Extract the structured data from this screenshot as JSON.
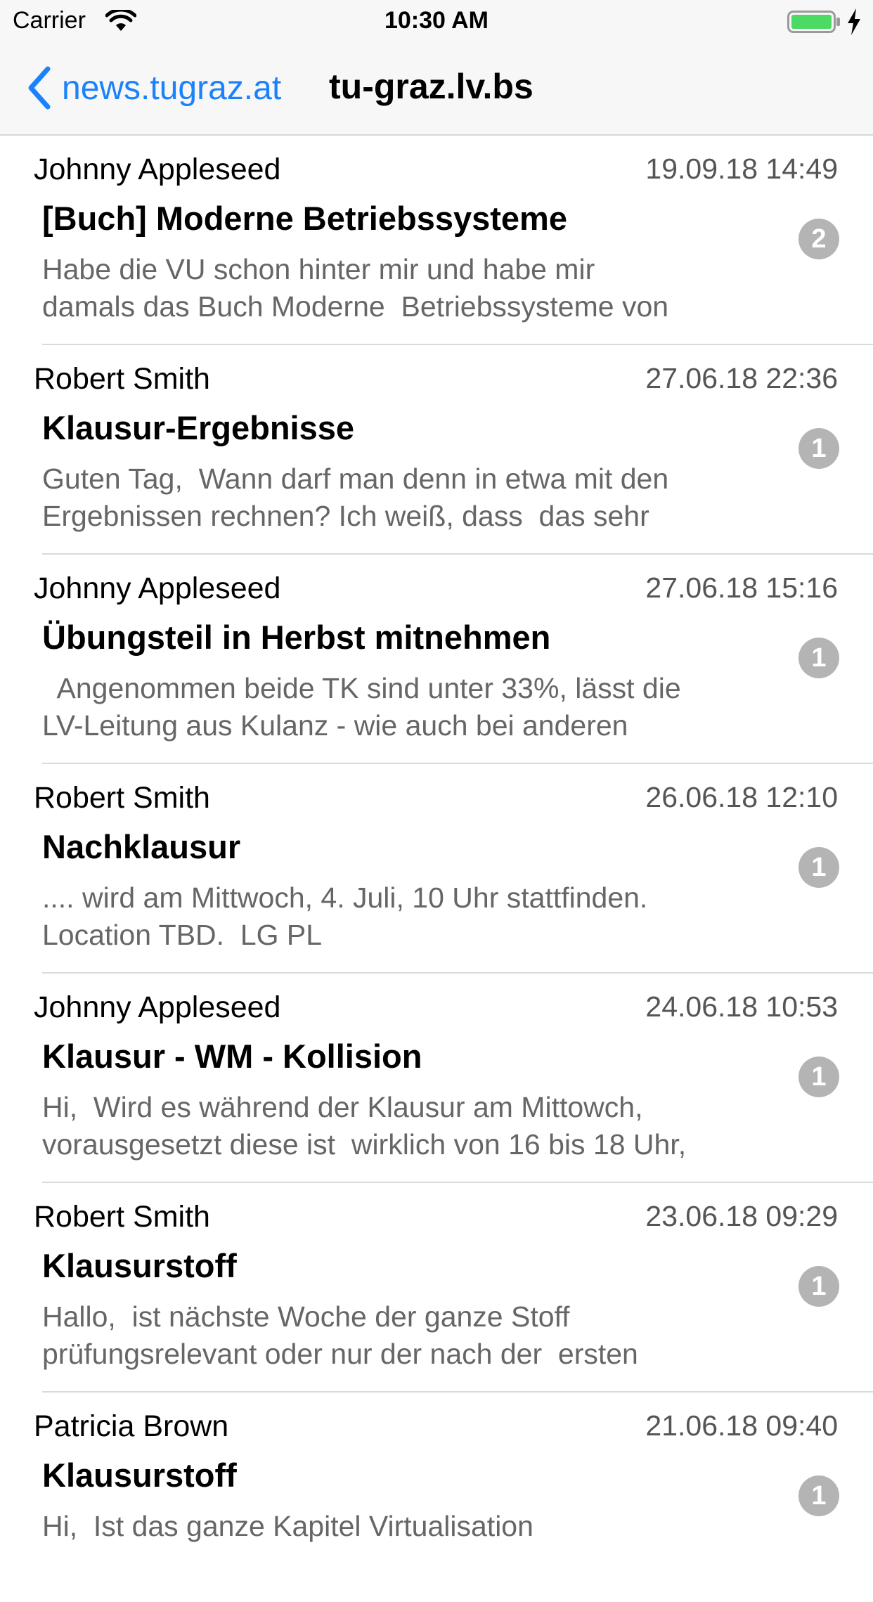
{
  "status_bar": {
    "carrier": "Carrier",
    "time": "10:30 AM",
    "battery_color": "#4cd964"
  },
  "nav": {
    "back_label": "news.tugraz.at",
    "title": "tu-graz.lv.bs",
    "accent_color": "#1a82fb"
  },
  "threads": [
    {
      "author": "Johnny Appleseed",
      "date": "19.09.18 14:49",
      "subject": "[Buch] Moderne Betriebssysteme",
      "preview": "Habe die VU schon hinter mir und habe mir\ndamals das Buch Moderne  Betriebssysteme von",
      "count": "2"
    },
    {
      "author": "Robert Smith",
      "date": "27.06.18 22:36",
      "subject": "Klausur-Ergebnisse",
      "preview": "Guten Tag,  Wann darf man denn in etwa mit den\nErgebnissen rechnen? Ich weiß, dass  das sehr",
      "count": "1"
    },
    {
      "author": "Johnny Appleseed",
      "date": "27.06.18 15:16",
      "subject": "Übungsteil in Herbst mitnehmen",
      "preview": "  Angenommen beide TK sind unter 33%, lässt die\nLV-Leitung aus Kulanz - wie auch bei anderen",
      "count": "1"
    },
    {
      "author": "Robert Smith",
      "date": "26.06.18 12:10",
      "subject": "Nachklausur",
      "preview": ".... wird am Mittwoch, 4. Juli, 10 Uhr stattfinden.\nLocation TBD.  LG PL",
      "count": "1"
    },
    {
      "author": "Johnny Appleseed",
      "date": "24.06.18 10:53",
      "subject": "Klausur - WM - Kollision",
      "preview": "Hi,  Wird es während der Klausur am Mittowch,\nvorausgesetzt diese ist  wirklich von 16 bis 18 Uhr,",
      "count": "1"
    },
    {
      "author": "Robert Smith",
      "date": "23.06.18 09:29",
      "subject": "Klausurstoff",
      "preview": "Hallo,  ist nächste Woche der ganze Stoff\nprüfungsrelevant oder nur der nach der  ersten",
      "count": "1"
    },
    {
      "author": "Patricia Brown",
      "date": "21.06.18 09:40",
      "subject": "Klausurstoff",
      "preview": "Hi,  Ist das ganze Kapitel Virtualisation",
      "count": "1"
    }
  ]
}
